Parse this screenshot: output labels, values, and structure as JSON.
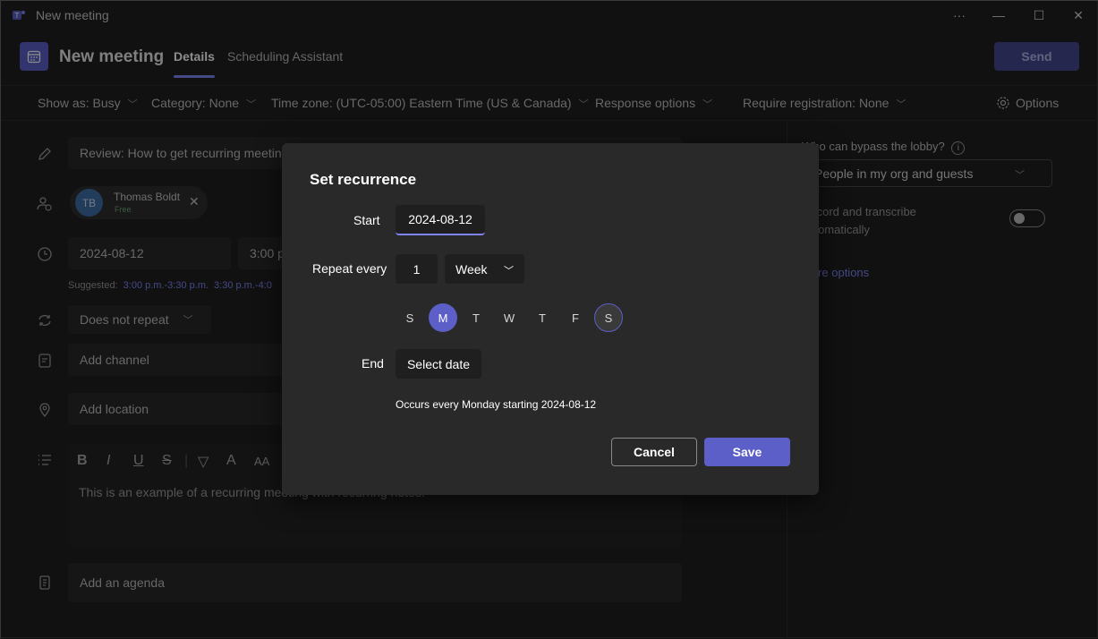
{
  "window": {
    "title": "New meeting",
    "more_label": "···",
    "minimize_label": "—",
    "maximize_label": "☐",
    "close_label": "✕"
  },
  "header": {
    "title": "New meeting",
    "tabs": [
      {
        "label": "Details",
        "active": true
      },
      {
        "label": "Scheduling Assistant",
        "active": false
      }
    ],
    "send_label": "Send"
  },
  "options_bar": {
    "show_as": "Show as: Busy",
    "category": "Category: None",
    "time_zone": "Time zone: (UTC-05:00) Eastern Time (US & Canada)",
    "response_options": "Response options",
    "require_registration": "Require registration: None",
    "options_label": "Options"
  },
  "form": {
    "title_value": "Review: How to get recurring meeting",
    "attendee": {
      "initials": "TB",
      "name": "Thomas Boldt",
      "status": "Free"
    },
    "date_value": "2024-08-12",
    "time_value": "3:00 p",
    "suggested_label": "Suggested:",
    "suggested_times": [
      "3:00 p.m.-3:30 p.m.",
      "3:30 p.m.-4:0"
    ],
    "repeat_value": "Does not repeat",
    "channel_placeholder": "Add channel",
    "location_placeholder": "Add location",
    "body_text": "This is an example of a recurring meeting with recurring notes.",
    "agenda_placeholder": "Add an agenda"
  },
  "right_panel": {
    "lobby_label": "Who can bypass the lobby?",
    "lobby_value": "People in my org and guests",
    "record_label": "Record and transcribe automatically",
    "more_options": "More options"
  },
  "dialog": {
    "title": "Set recurrence",
    "start_label": "Start",
    "start_value": "2024-08-12",
    "repeat_label": "Repeat every",
    "repeat_count": "1",
    "repeat_unit": "Week",
    "days": [
      {
        "label": "S",
        "state": "off"
      },
      {
        "label": "M",
        "state": "selected"
      },
      {
        "label": "T",
        "state": "off"
      },
      {
        "label": "W",
        "state": "off"
      },
      {
        "label": "T",
        "state": "off"
      },
      {
        "label": "F",
        "state": "off"
      },
      {
        "label": "S",
        "state": "hover"
      }
    ],
    "end_label": "End",
    "end_value": "Select date",
    "summary": "Occurs every Monday starting 2024-08-12",
    "cancel_label": "Cancel",
    "save_label": "Save"
  },
  "colors": {
    "accent": "#5b5fc7",
    "accent_light": "#7f85f5",
    "background": "#1f1f1f",
    "dialog_bg": "#292929"
  }
}
